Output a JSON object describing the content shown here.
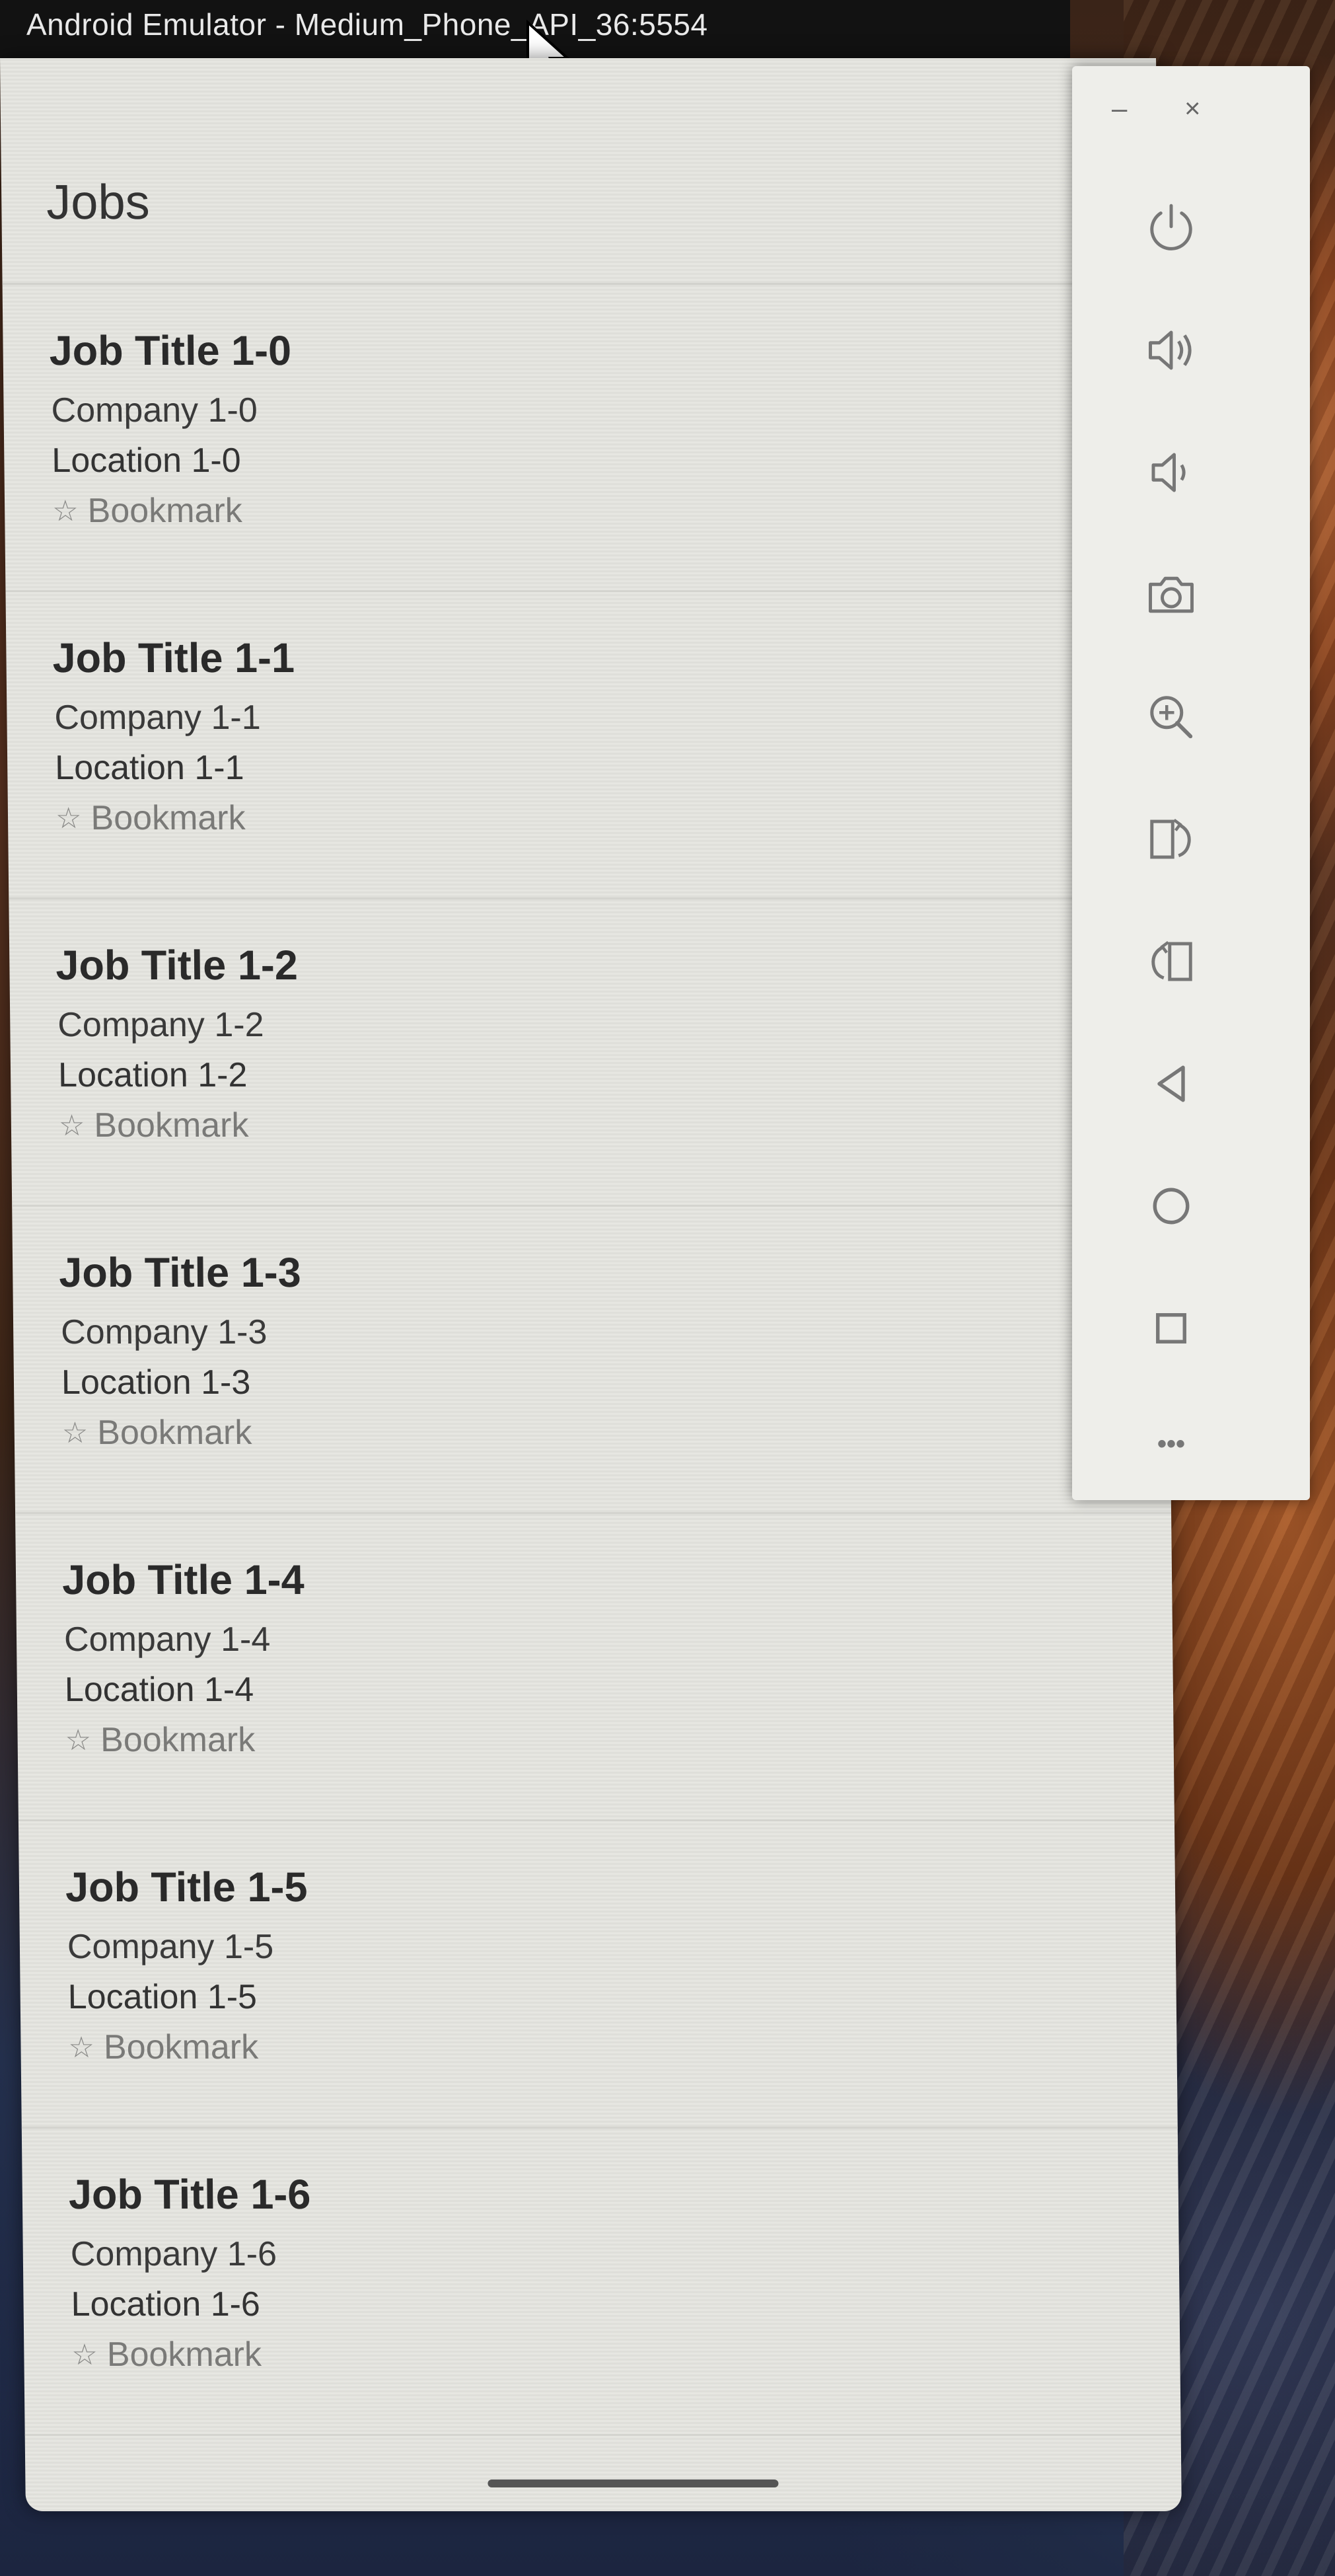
{
  "window": {
    "title": "Android Emulator - Medium_Phone_API_36:5554"
  },
  "app": {
    "title": "Jobs",
    "bookmark_icon": "☆",
    "jobs": [
      {
        "title": "Job Title 1-0",
        "company": "Company 1-0",
        "location": "Location 1-0",
        "bookmark": "Bookmark"
      },
      {
        "title": "Job Title 1-1",
        "company": "Company 1-1",
        "location": "Location 1-1",
        "bookmark": "Bookmark"
      },
      {
        "title": "Job Title 1-2",
        "company": "Company 1-2",
        "location": "Location 1-2",
        "bookmark": "Bookmark"
      },
      {
        "title": "Job Title 1-3",
        "company": "Company 1-3",
        "location": "Location 1-3",
        "bookmark": "Bookmark"
      },
      {
        "title": "Job Title 1-4",
        "company": "Company 1-4",
        "location": "Location 1-4",
        "bookmark": "Bookmark"
      },
      {
        "title": "Job Title 1-5",
        "company": "Company 1-5",
        "location": "Location 1-5",
        "bookmark": "Bookmark"
      },
      {
        "title": "Job Title 1-6",
        "company": "Company 1-6",
        "location": "Location 1-6",
        "bookmark": "Bookmark"
      }
    ]
  },
  "toolbar": {
    "minimize": "–",
    "close": "×",
    "more": "•••",
    "icons": [
      "power-icon",
      "volume-up-icon",
      "volume-down-icon",
      "camera-icon",
      "zoom-icon",
      "rotate-left-icon",
      "rotate-right-icon",
      "back-icon",
      "home-icon",
      "overview-icon",
      "more-icon"
    ]
  },
  "colors": {
    "screen_bg": "#e6e6e1",
    "title_bar": "#121212",
    "toolbar_bg": "#eeeeea",
    "icon": "#777777"
  }
}
